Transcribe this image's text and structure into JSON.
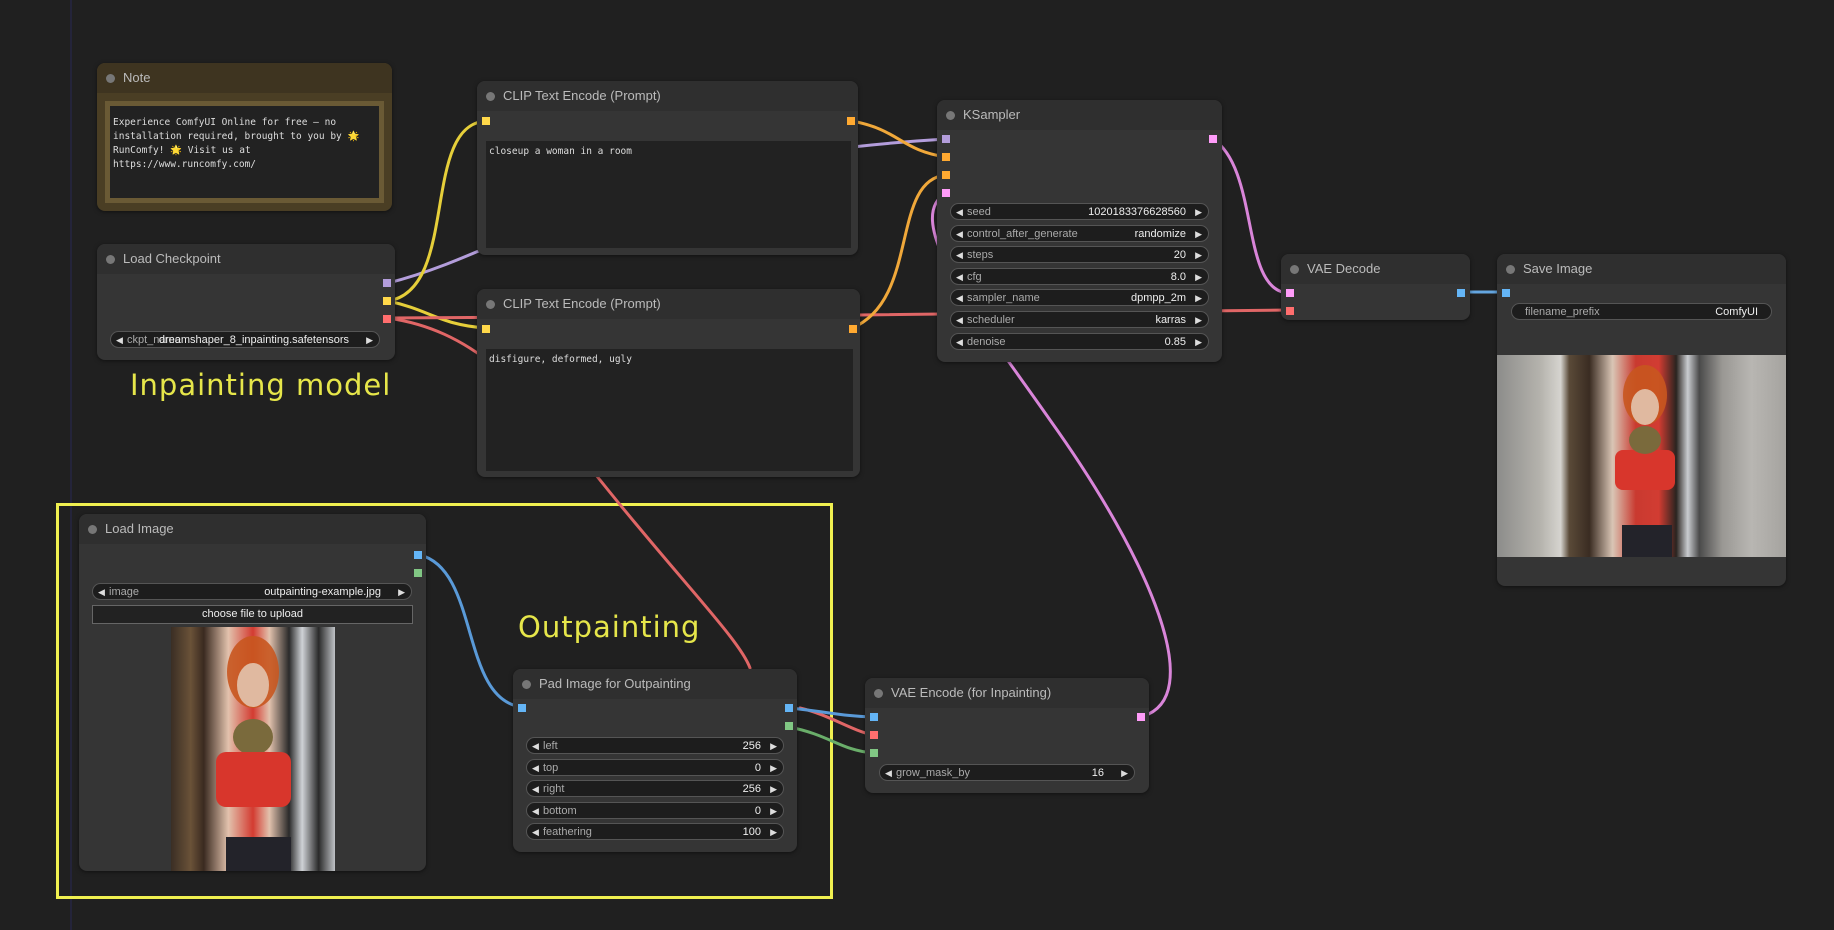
{
  "canvas": {
    "groups": [
      {
        "title": "Inpainting model"
      },
      {
        "title": "Outpainting"
      }
    ]
  },
  "nodes": {
    "note": {
      "title": "Note",
      "text": "Experience ComfyUI Online for free — no installation required, brought to you by 🌟 RunComfy! 🌟 Visit us at https://www.runcomfy.com/"
    },
    "load_checkpoint": {
      "title": "Load Checkpoint",
      "widgets": [
        {
          "label": "ckpt_name",
          "value": "dreamshaper_8_inpainting.safetensors"
        }
      ]
    },
    "clip_positive": {
      "title": "CLIP Text Encode (Prompt)",
      "text": "closeup a woman in a room"
    },
    "clip_negative": {
      "title": "CLIP Text Encode (Prompt)",
      "text": "disfigure, deformed, ugly"
    },
    "ksampler": {
      "title": "KSampler",
      "widgets": [
        {
          "label": "seed",
          "value": "1020183376628560"
        },
        {
          "label": "control_after_generate",
          "value": "randomize"
        },
        {
          "label": "steps",
          "value": "20"
        },
        {
          "label": "cfg",
          "value": "8.0"
        },
        {
          "label": "sampler_name",
          "value": "dpmpp_2m"
        },
        {
          "label": "scheduler",
          "value": "karras"
        },
        {
          "label": "denoise",
          "value": "0.85"
        }
      ]
    },
    "vae_decode": {
      "title": "VAE Decode"
    },
    "save_image": {
      "title": "Save Image",
      "widgets": [
        {
          "label": "filename_prefix",
          "value": "ComfyUI"
        }
      ]
    },
    "load_image": {
      "title": "Load Image",
      "widgets": [
        {
          "label": "image",
          "value": "outpainting-example.jpg"
        }
      ],
      "upload_label": "choose file to upload"
    },
    "pad_image": {
      "title": "Pad Image for Outpainting",
      "widgets": [
        {
          "label": "left",
          "value": "256"
        },
        {
          "label": "top",
          "value": "0"
        },
        {
          "label": "right",
          "value": "256"
        },
        {
          "label": "bottom",
          "value": "0"
        },
        {
          "label": "feathering",
          "value": "100"
        }
      ]
    },
    "vae_encode": {
      "title": "VAE Encode (for Inpainting)",
      "widgets": [
        {
          "label": "grow_mask_by",
          "value": "16"
        }
      ]
    }
  },
  "colors": {
    "model": "#b39ddb",
    "clip": "#ffd84a",
    "vae": "#ff6e6e",
    "conditioning": "#ffa931",
    "latent": "#ff9cf9",
    "image": "#64b5f6",
    "mask": "#81c784",
    "group_border": "#f0f050"
  }
}
